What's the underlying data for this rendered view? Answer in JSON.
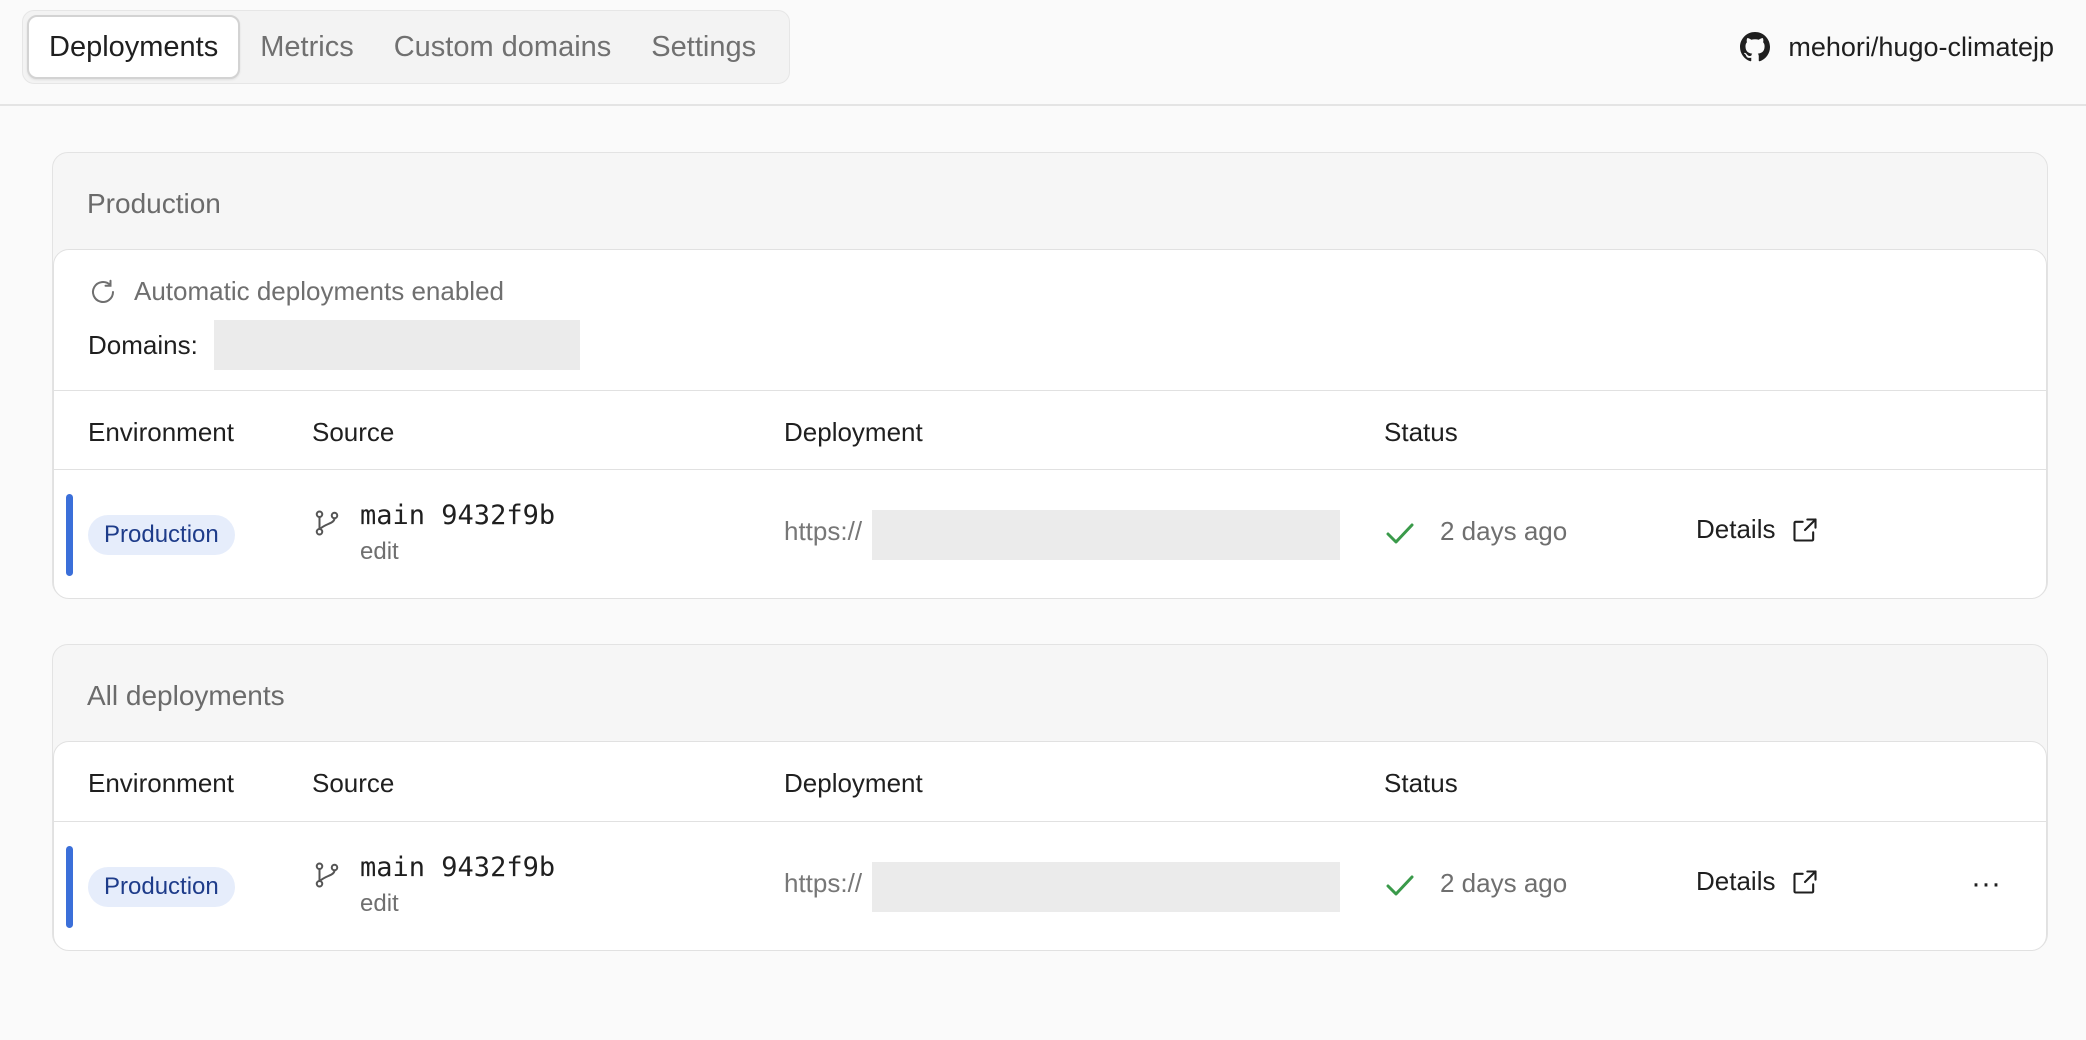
{
  "nav": {
    "tabs": [
      {
        "label": "Deployments",
        "active": true
      },
      {
        "label": "Metrics"
      },
      {
        "label": "Custom domains"
      },
      {
        "label": "Settings"
      }
    ],
    "repo": {
      "name": "mehori/hugo-climatejp",
      "icon": "github-icon"
    }
  },
  "production": {
    "title": "Production",
    "auto_deploy": "Automatic deployments enabled",
    "domains_label": "Domains:",
    "columns": [
      "Environment",
      "Source",
      "Deployment",
      "Status"
    ],
    "row": {
      "environment": "Production",
      "branch": "main",
      "commit": "9432f9b",
      "message": "edit",
      "url_prefix": "https://",
      "status_time": "2 days ago",
      "details_label": "Details"
    }
  },
  "all_deployments": {
    "title": "All deployments",
    "columns": [
      "Environment",
      "Source",
      "Deployment",
      "Status"
    ],
    "rows": [
      {
        "environment": "Production",
        "branch": "main",
        "commit": "9432f9b",
        "message": "edit",
        "url_prefix": "https://",
        "status_time": "2 days ago",
        "details_label": "Details",
        "more_label": "···"
      }
    ]
  },
  "colors": {
    "accent": "#3b6fd9",
    "success": "#3a9a4a",
    "badge_bg": "#e6edfb",
    "badge_text": "#1e3c8a"
  }
}
